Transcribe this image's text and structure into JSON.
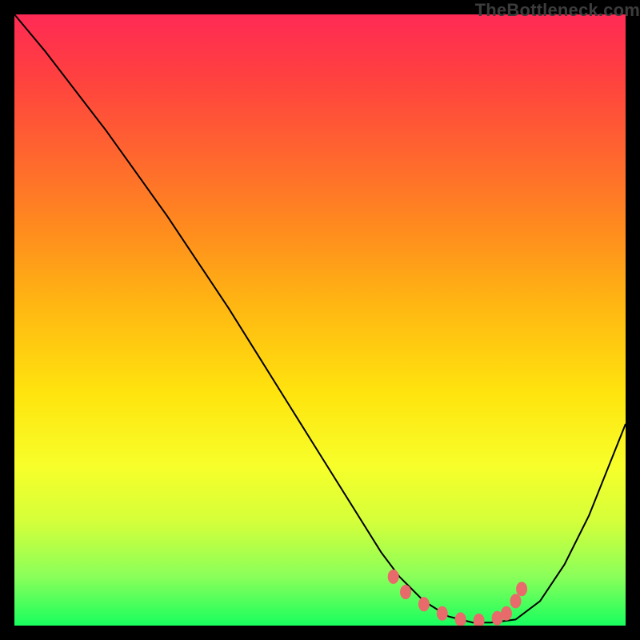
{
  "watermark": "TheBottleneck.com",
  "colors": {
    "gradient_top": "#ff2a55",
    "gradient_bottom": "#18ff5e",
    "curve": "#000000",
    "dots": "#e86a6a",
    "background": "#000000"
  },
  "chart_data": {
    "type": "line",
    "title": "",
    "xlabel": "",
    "ylabel": "",
    "xlim": [
      0,
      100
    ],
    "ylim": [
      0,
      100
    ],
    "grid": false,
    "series": [
      {
        "name": "curve",
        "x": [
          0,
          5,
          10,
          15,
          20,
          25,
          30,
          35,
          40,
          45,
          50,
          55,
          60,
          63,
          67,
          71,
          75,
          78,
          82,
          86,
          90,
          94,
          100
        ],
        "y": [
          100,
          94,
          87.5,
          81,
          74,
          67,
          59.5,
          52,
          44,
          36,
          28,
          20,
          12,
          8,
          4,
          1.5,
          0.5,
          0.5,
          1,
          4,
          10,
          18,
          33
        ]
      }
    ],
    "annotations": {
      "dots": [
        {
          "x": 62,
          "y": 8
        },
        {
          "x": 64,
          "y": 5.5
        },
        {
          "x": 67,
          "y": 3.5
        },
        {
          "x": 70,
          "y": 2
        },
        {
          "x": 73,
          "y": 1
        },
        {
          "x": 76,
          "y": 0.8
        },
        {
          "x": 79,
          "y": 1.2
        },
        {
          "x": 80.5,
          "y": 2
        },
        {
          "x": 82,
          "y": 4
        },
        {
          "x": 83,
          "y": 6
        }
      ]
    }
  }
}
